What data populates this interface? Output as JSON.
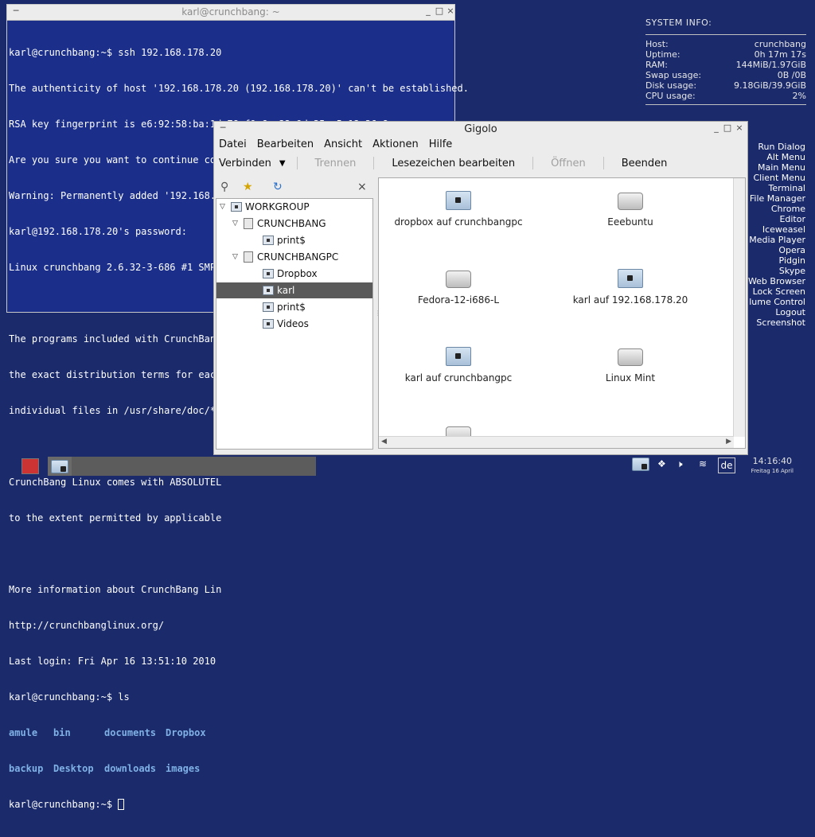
{
  "terminal": {
    "title": "karl@crunchbang: ~",
    "lines": [
      "karl@crunchbang:~$ ssh 192.168.178.20",
      "The authenticity of host '192.168.178.20 (192.168.178.20)' can't be established.",
      "RSA key fingerprint is e6:92:58:ba:1d:78:f9:6e:32:9d:35:c5:12:36:8c:ea.",
      "Are you sure you want to continue connecting (yes/no)? yes",
      "Warning: Permanently added '192.168.178.20' (RSA) to the list of known hosts.",
      "karl@192.168.178.20's password:",
      "Linux crunchbang 2.6.32-3-686 #1 SMP Tue Mar 9 23:45:38 UTC 2010 i686",
      "",
      "The programs included with CrunchBang Linux are free software;",
      "the exact distribution terms for each",
      "individual files in /usr/share/doc/*/",
      "",
      "CrunchBang Linux comes with ABSOLUTEL",
      "to the extent permitted by applicable",
      "",
      "More information about CrunchBang Lin",
      "http://crunchbanglinux.org/",
      "Last login: Fri Apr 16 13:51:10 2010",
      "karl@crunchbang:~$ ls"
    ],
    "ls_row1": [
      "amule",
      "bin",
      "documents",
      "Dropbox"
    ],
    "ls_row2": [
      "backup",
      "Desktop",
      "downloads",
      "images"
    ],
    "prompt": "karl@crunchbang:~$ "
  },
  "sysinfo": {
    "header": "SYSTEM INFO:",
    "rows": [
      {
        "label": "Host:",
        "value": "crunchbang"
      },
      {
        "label": "Uptime:",
        "value": "0h 17m 17s"
      },
      {
        "label": "RAM:",
        "value": "144MiB/1.97GiB"
      },
      {
        "label": "Swap usage:",
        "value": "0B  /0B"
      },
      {
        "label": "Disk usage:",
        "value": "9.18GiB/39.9GiB"
      },
      {
        "label": "CPU usage:",
        "value": "2%"
      }
    ]
  },
  "shortcuts": [
    "Run Dialog",
    "Alt Menu",
    "Main Menu",
    "Client Menu",
    "Terminal",
    "File Manager",
    "Chrome",
    "Editor",
    "Iceweasel",
    "Media Player",
    "Opera",
    "Pidgin",
    "Skype",
    "Web Browser",
    "Lock Screen",
    "lume Control",
    "Logout",
    "Screenshot"
  ],
  "gigolo": {
    "title": "Gigolo",
    "menu": [
      "Datei",
      "Bearbeiten",
      "Ansicht",
      "Aktionen",
      "Hilfe"
    ],
    "toolbar": {
      "connect": "Verbinden",
      "disconnect": "Trennen",
      "bookmarks": "Lesezeichen bearbeiten",
      "open": "Öffnen",
      "quit": "Beenden"
    },
    "tree": {
      "workgroup": "WORKGROUP",
      "host1": "CRUNCHBANG",
      "host1_share": "print$",
      "host2": "CRUNCHBANGPC",
      "host2_shares": [
        "Dropbox",
        "karl",
        "print$",
        "Videos"
      ]
    },
    "items": [
      "dropbox auf crunchbangpc",
      "Eeebuntu",
      "Fedora-12-i686-L",
      "karl auf 192.168.178.20",
      "karl auf crunchbangpc",
      "Linux Mint"
    ]
  },
  "taskbar": {
    "time": "14:16:40",
    "date": "Freitag 16 April",
    "layout": "de"
  }
}
